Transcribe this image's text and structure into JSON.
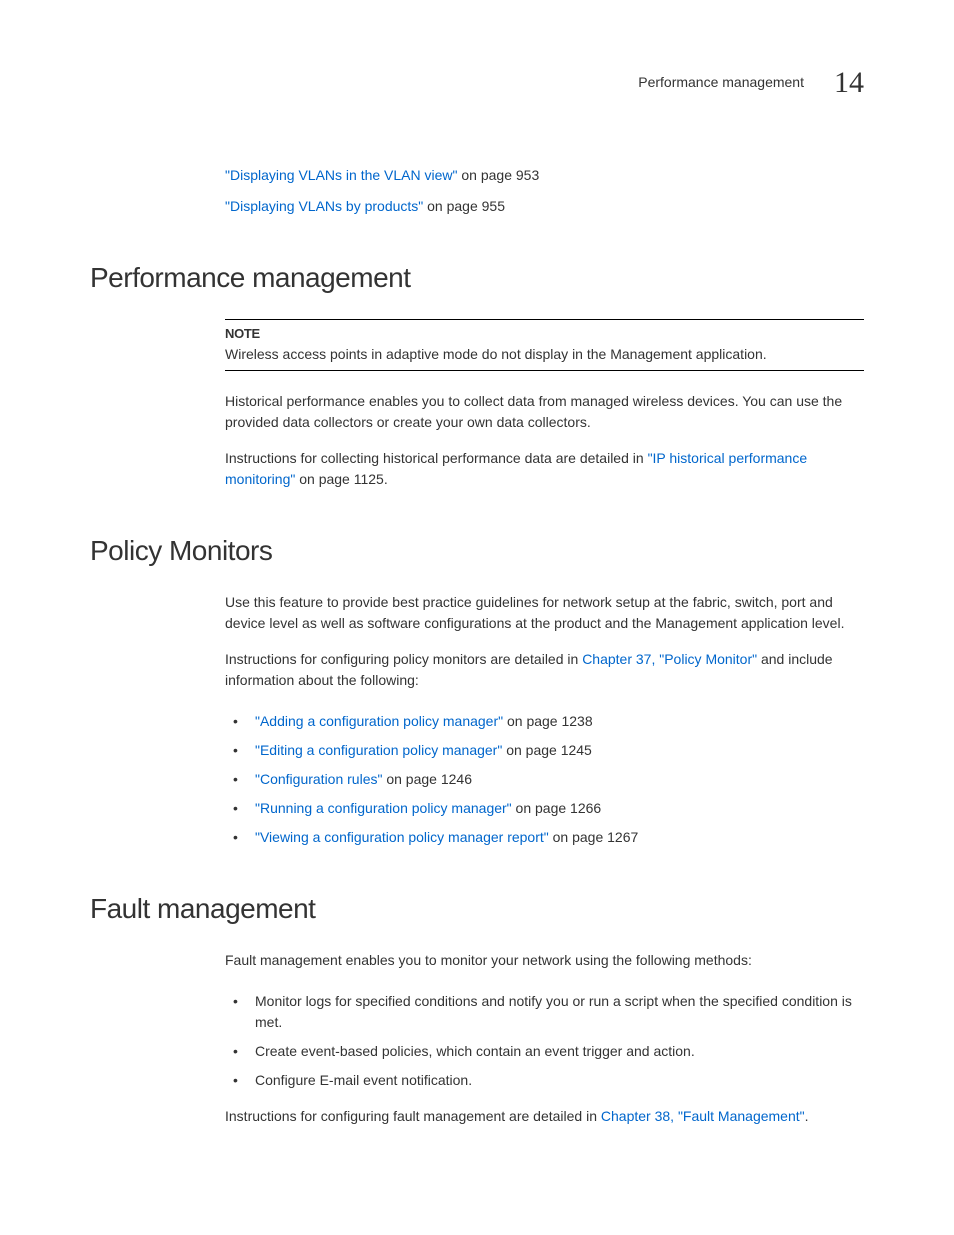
{
  "header": {
    "text": "Performance management",
    "chapter_number": "14"
  },
  "top_links": [
    {
      "link": "\"Displaying VLANs in the VLAN view\"",
      "suffix": " on page 953"
    },
    {
      "link": "\"Displaying VLANs by products\"",
      "suffix": " on page 955"
    }
  ],
  "sections": {
    "performance": {
      "title": "Performance management",
      "note_label": "NOTE",
      "note_text": "Wireless access points in adaptive mode do not display in the Management application.",
      "para1": "Historical performance enables you to collect data from managed wireless devices. You can use the provided data collectors or create your own data collectors.",
      "para2_prefix": "Instructions for collecting historical performance data are detailed in ",
      "para2_link": "\"IP historical performance monitoring\"",
      "para2_suffix": " on page 1125."
    },
    "policy": {
      "title": "Policy Monitors",
      "para1": "Use this feature to provide best practice guidelines for network setup at the fabric, switch, port and device level as well as software configurations at the product and the Management application level.",
      "para2_prefix": "Instructions for configuring policy monitors are detailed in ",
      "para2_link": "Chapter 37, \"Policy Monitor\"",
      "para2_suffix": " and include information about the following:",
      "items": [
        {
          "link": "\"Adding a configuration policy manager\"",
          "suffix": " on page 1238"
        },
        {
          "link": "\"Editing a configuration policy manager\"",
          "suffix": " on page 1245"
        },
        {
          "link": "\"Configuration rules\"",
          "suffix": " on page 1246"
        },
        {
          "link": "\"Running a configuration policy manager\"",
          "suffix": " on page 1266"
        },
        {
          "link": "\"Viewing a configuration policy manager report\"",
          "suffix": " on page 1267"
        }
      ]
    },
    "fault": {
      "title": "Fault management",
      "para1": "Fault management enables you to monitor your network using the following methods:",
      "items": [
        {
          "text": "Monitor logs for specified conditions and notify you or run a script when the specified condition is met."
        },
        {
          "text": "Create event-based policies, which contain an event trigger and action."
        },
        {
          "text": "Configure E-mail event notification."
        }
      ],
      "para2_prefix": "Instructions for configuring fault management are detailed in ",
      "para2_link": "Chapter 38, \"Fault Management\"",
      "para2_suffix": "."
    }
  }
}
